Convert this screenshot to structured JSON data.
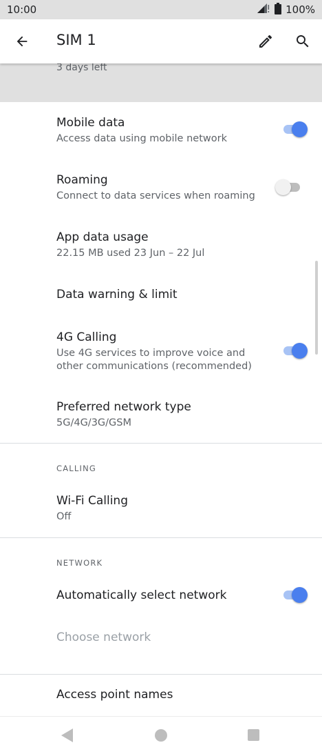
{
  "status_bar": {
    "time": "10:00",
    "battery": "100%"
  },
  "app_bar": {
    "title": "SIM 1"
  },
  "banner": {
    "summary": "3 days left"
  },
  "items": {
    "mobile_data": {
      "title": "Mobile data",
      "summary": "Access data using mobile network",
      "enabled": true
    },
    "roaming": {
      "title": "Roaming",
      "summary": "Connect to data services when roaming",
      "enabled": false
    },
    "app_data_usage": {
      "title": "App data usage",
      "summary": "22.15 MB used 23 Jun – 22 Jul"
    },
    "data_warning": {
      "title": "Data warning & limit"
    },
    "calling_4g": {
      "title": "4G Calling",
      "summary": "Use 4G services to improve voice and other communications (recommended)",
      "enabled": true
    },
    "preferred_network": {
      "title": "Preferred network type",
      "summary": "5G/4G/3G/GSM"
    }
  },
  "calling": {
    "header": "CALLING",
    "wifi_calling": {
      "title": "Wi-Fi Calling",
      "summary": "Off"
    }
  },
  "network": {
    "header": "NETWORK",
    "auto_select": {
      "title": "Automatically select network",
      "enabled": true
    },
    "choose_network": {
      "title": "Choose network"
    }
  },
  "apn": {
    "title": "Access point names"
  },
  "colors": {
    "accent": "#4a7fee",
    "accent_track": "#a8c3f5",
    "text_primary": "#202124",
    "text_secondary": "#5f6368",
    "disabled": "#9aa0a6"
  }
}
